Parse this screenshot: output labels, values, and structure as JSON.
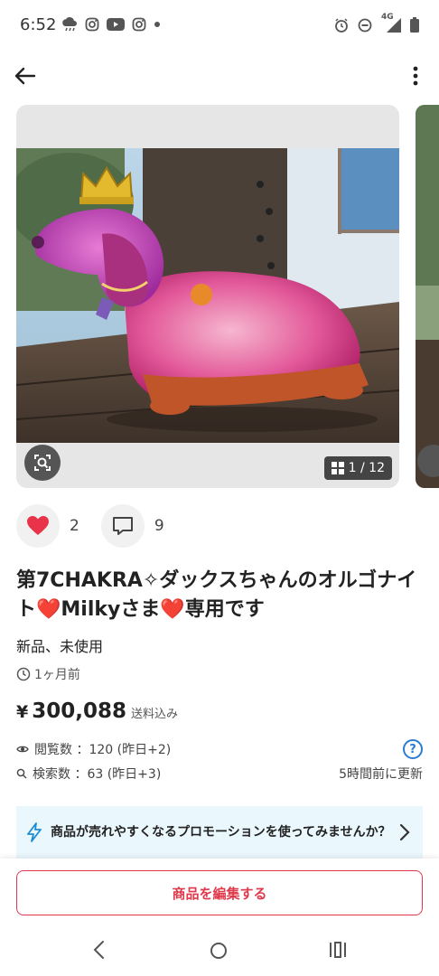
{
  "status_bar": {
    "time": "6:52",
    "network": "4G",
    "left_icons": [
      "cloud-rain-icon",
      "instagram-icon",
      "youtube-icon",
      "instagram-icon",
      "dot-icon"
    ],
    "right_icons": [
      "alarm-icon",
      "do-not-disturb-icon",
      "signal-icon",
      "battery-icon"
    ]
  },
  "app_bar": {
    "back_icon": "arrow-left-icon",
    "menu_icon": "more-vert-icon"
  },
  "gallery": {
    "counter": "1 / 12",
    "lens_icon": "image-search-icon"
  },
  "actions": {
    "likes": "2",
    "comments": "9"
  },
  "item": {
    "title": "第7CHAKRA✧ダックスちゃんのオルゴナイト❤️Milkyさま❤️専用です",
    "condition": "新品、未使用",
    "posted": "1ヶ月前",
    "price_symbol": "¥",
    "price": "300,088",
    "shipping": "送料込み"
  },
  "stats": {
    "views": "閲覧数 ：120 (昨日+2)",
    "searches": "検索数 ：63 (昨日+3)",
    "updated": "5時間前に更新",
    "help": "?"
  },
  "promo": {
    "text": "商品が売れやすくなるプロモーションを使ってみませんか？"
  },
  "edit_button": {
    "label": "商品を編集する"
  },
  "colors": {
    "accent_red": "#e0394b",
    "like_red": "#e8334a",
    "help_blue": "#2b7cd3",
    "promo_bg": "#eaf7fd"
  }
}
